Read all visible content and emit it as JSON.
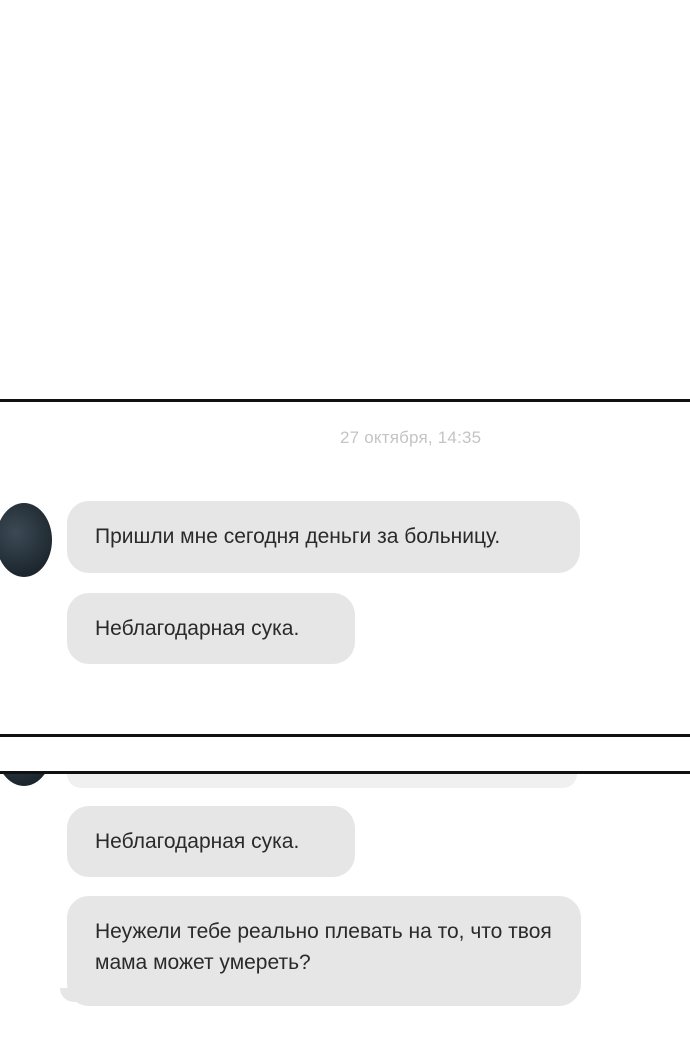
{
  "chat": {
    "top_panel": {
      "timestamp": "27 октября, 14:35",
      "messages": [
        "Пришли мне сегодня деньги за больницу.",
        "Неблагодарная сука."
      ]
    },
    "bottom_panel": {
      "messages": [
        "Неблагодарная сука.",
        "Неужели тебе реально плевать на то, что твоя мама может умереть?"
      ]
    }
  },
  "colors": {
    "bubble": "#e6e6e6",
    "timestamp": "#c4c4c4",
    "divider": "#111111",
    "avatar": "#1e2830"
  }
}
